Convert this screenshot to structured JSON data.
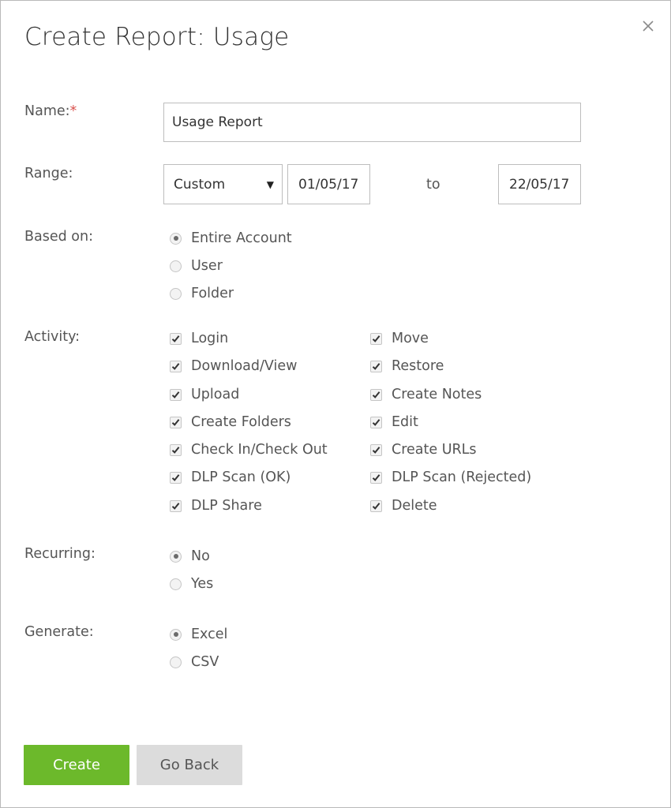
{
  "dialog": {
    "title": "Create Report: Usage",
    "close_icon": "close-icon"
  },
  "name": {
    "label": "Name:",
    "required_mark": "*",
    "value": "Usage Report"
  },
  "range": {
    "label": "Range:",
    "selected": "Custom",
    "dropdown_icon": "caret-down-icon",
    "start": "01/05/17",
    "to": "to",
    "end": "22/05/17"
  },
  "based_on": {
    "label": "Based on:",
    "options": [
      {
        "label": "Entire Account",
        "checked": true
      },
      {
        "label": "User",
        "checked": false
      },
      {
        "label": "Folder",
        "checked": false
      }
    ]
  },
  "activity": {
    "label": "Activity:",
    "left": [
      {
        "label": "Login",
        "checked": true
      },
      {
        "label": "Download/View",
        "checked": true
      },
      {
        "label": "Upload",
        "checked": true
      },
      {
        "label": "Create Folders",
        "checked": true
      },
      {
        "label": "Check In/Check Out",
        "checked": true
      },
      {
        "label": "DLP Scan (OK)",
        "checked": true
      },
      {
        "label": "DLP Share",
        "checked": true
      }
    ],
    "right": [
      {
        "label": "Move",
        "checked": true
      },
      {
        "label": "Restore",
        "checked": true
      },
      {
        "label": "Create Notes",
        "checked": true
      },
      {
        "label": "Edit",
        "checked": true
      },
      {
        "label": "Create URLs",
        "checked": true
      },
      {
        "label": "DLP Scan (Rejected)",
        "checked": true
      },
      {
        "label": "Delete",
        "checked": true
      }
    ]
  },
  "recurring": {
    "label": "Recurring:",
    "options": [
      {
        "label": "No",
        "checked": true
      },
      {
        "label": "Yes",
        "checked": false
      }
    ]
  },
  "generate": {
    "label": "Generate:",
    "options": [
      {
        "label": "Excel",
        "checked": true
      },
      {
        "label": "CSV",
        "checked": false
      }
    ]
  },
  "buttons": {
    "create": "Create",
    "go_back": "Go Back"
  },
  "colors": {
    "primary": "#6cb92b",
    "secondary": "#dcdcdc",
    "required": "#d9534f"
  }
}
